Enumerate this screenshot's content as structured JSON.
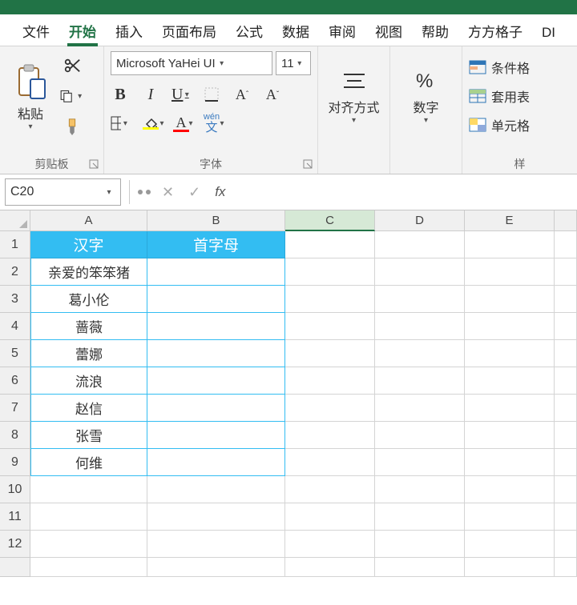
{
  "tabs": {
    "file": "文件",
    "home": "开始",
    "insert": "插入",
    "layout": "页面布局",
    "formulas": "公式",
    "data": "数据",
    "review": "审阅",
    "view": "视图",
    "help": "帮助",
    "square": "方方格子",
    "diy": "DI"
  },
  "ribbon": {
    "clipboard": {
      "paste": "粘贴",
      "label": "剪贴板"
    },
    "font": {
      "name": "Microsoft YaHei UI",
      "size": "11",
      "wen_top": "wén",
      "wen_bottom": "文",
      "label": "字体"
    },
    "align": {
      "title": "对齐方式"
    },
    "number": {
      "title": "数字"
    },
    "styles": {
      "cond": "条件格",
      "table": "套用表",
      "cell": "单元格",
      "label": "样"
    }
  },
  "fx": {
    "namebox": "C20",
    "fx": "fx"
  },
  "columns": [
    "A",
    "B",
    "C",
    "D",
    "E"
  ],
  "table": {
    "headers": {
      "a": "汉字",
      "b": "首字母"
    },
    "rows": [
      {
        "a": "亲爱的笨笨猪",
        "b": ""
      },
      {
        "a": "葛小伦",
        "b": ""
      },
      {
        "a": "蔷薇",
        "b": ""
      },
      {
        "a": "蕾娜",
        "b": ""
      },
      {
        "a": "流浪",
        "b": ""
      },
      {
        "a": "赵信",
        "b": ""
      },
      {
        "a": "张雪",
        "b": ""
      },
      {
        "a": "何维",
        "b": ""
      }
    ]
  }
}
